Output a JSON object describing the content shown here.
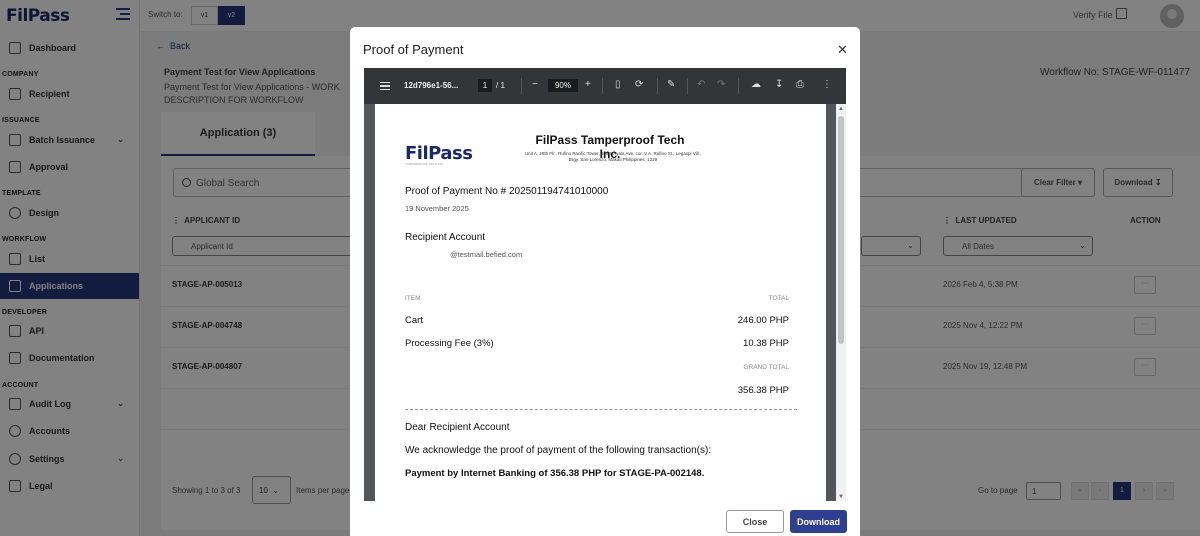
{
  "app": {
    "logo": "FilPass"
  },
  "topbar": {
    "switch_label": "Switch to:",
    "v1": "v1",
    "v2": "v2",
    "verify_file": "Verify File"
  },
  "sidebar": {
    "sections": {
      "company": "COMPANY",
      "issuance": "ISSUANCE",
      "template": "TEMPLATE",
      "workflow": "WORKFLOW",
      "developer": "DEVELOPER",
      "account": "ACCOUNT"
    },
    "items": {
      "dashboard": "Dashboard",
      "recipient": "Recipient",
      "batch_issuance": "Batch Issuance",
      "approval": "Approval",
      "design": "Design",
      "list": "List",
      "applications": "Applications",
      "api": "API",
      "documentation": "Documentation",
      "audit_log": "Audit Log",
      "accounts": "Accounts",
      "settings": "Settings",
      "legal": "Legal"
    }
  },
  "main": {
    "back": "Back",
    "title": "Payment Test for View Applications",
    "subtitle": "Payment Test for View Applications - WORK DESCRIPTION FOR WORKFLOW",
    "workflow_no": "Workflow No: STAGE-WF-011477",
    "tab": "Application (3)",
    "search_placeholder": "Global Search",
    "clear_filter": "Clear Filter",
    "download": "Download",
    "columns": {
      "applicant_id": "APPLICANT ID",
      "last_updated": "LAST UPDATED",
      "action": "ACTION"
    },
    "filters": {
      "applicant_id": "Applicant Id",
      "dates": "All Dates"
    },
    "rows": [
      {
        "id": "STAGE-AP-005013",
        "updated": "2026 Feb 4, 5:38 PM",
        "action": "···"
      },
      {
        "id": "STAGE-AP-004748",
        "updated": "2025 Nov 4, 12:22 PM",
        "action": "···"
      },
      {
        "id": "STAGE-AP-004807",
        "updated": "2025 Nov 19, 12:48 PM",
        "action": "···"
      }
    ],
    "pagination": {
      "showing": "Showing 1 to 3 of 3",
      "per_page": "10",
      "per_page_label": "Items per page",
      "goto": "Go to page",
      "goto_value": "1",
      "current": "1"
    }
  },
  "modal": {
    "title": "Proof of Payment",
    "close": "Close",
    "download": "Download",
    "viewer": {
      "filename": "12d796e1-56...",
      "page": "1",
      "page_total": "/  1",
      "zoom": "90%"
    },
    "doc": {
      "logo": "FilPass",
      "logo_sub": "TAMPERPROOF TECH INC.",
      "company": "FilPass Tamperproof Tech Inc.",
      "address": "Unit A, 29th Flr., Rufino Pacific Tower, 6784, Ayala Ave. cor. V.A. Rufino St., Legaspi Vill., Brgy. San Lorenzo, Makati Philippines, 1229",
      "proof_no": "Proof of Payment No # 2025011947410100​00",
      "date": "19 November 2025",
      "recipient": "Recipient Account",
      "email": "@testmail.befied.com",
      "item_header": "ITEM",
      "total_header": "TOTAL",
      "items": [
        {
          "name": "Cart",
          "amount": "246.00 PHP"
        },
        {
          "name": "Processing Fee (3%)",
          "amount": "10.38 PHP"
        }
      ],
      "grand_total_label": "GRAND TOTAL",
      "grand_total": "356.38 PHP",
      "dear": "Dear Recipient Account",
      "ack": "We acknowledge the proof of payment of the following transaction(s):",
      "payment": "Payment by Internet Banking of 356.38 PHP for STAGE-PA-002148."
    }
  }
}
